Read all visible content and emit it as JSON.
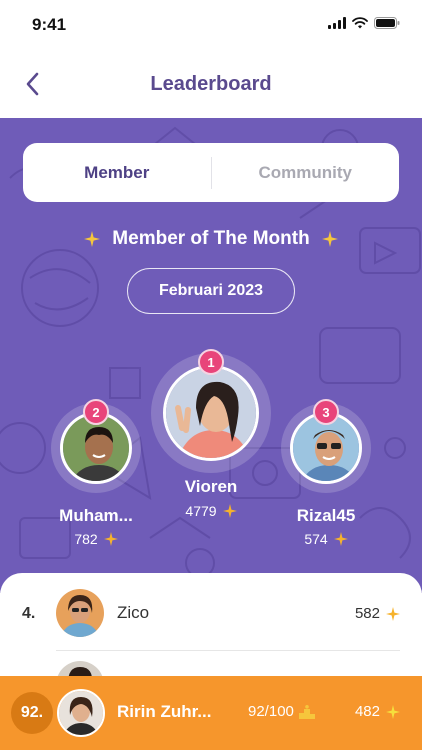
{
  "status": {
    "time": "9:41"
  },
  "header": {
    "title": "Leaderboard"
  },
  "tabs": [
    {
      "label": "Member",
      "active": true
    },
    {
      "label": "Community",
      "active": false
    }
  ],
  "hero": {
    "title": "Member of The Month",
    "month": "Februari 2023"
  },
  "podium": [
    {
      "rank": "1",
      "name": "Vioren",
      "points": "4779"
    },
    {
      "rank": "2",
      "name": "Muham...",
      "points": "782"
    },
    {
      "rank": "3",
      "name": "Rizal45",
      "points": "574"
    }
  ],
  "list": [
    {
      "rank": "4.",
      "name": "Zico",
      "points": "582"
    }
  ],
  "current_user": {
    "rank": "92.",
    "name": "Ririn Zuhr...",
    "progress": "92/100",
    "points": "482"
  },
  "colors": {
    "primary": "#6f5cb8",
    "title": "#5a4a8e",
    "badge": "#e8447a",
    "star": "#f6b22c",
    "bar": "#f6962c"
  }
}
